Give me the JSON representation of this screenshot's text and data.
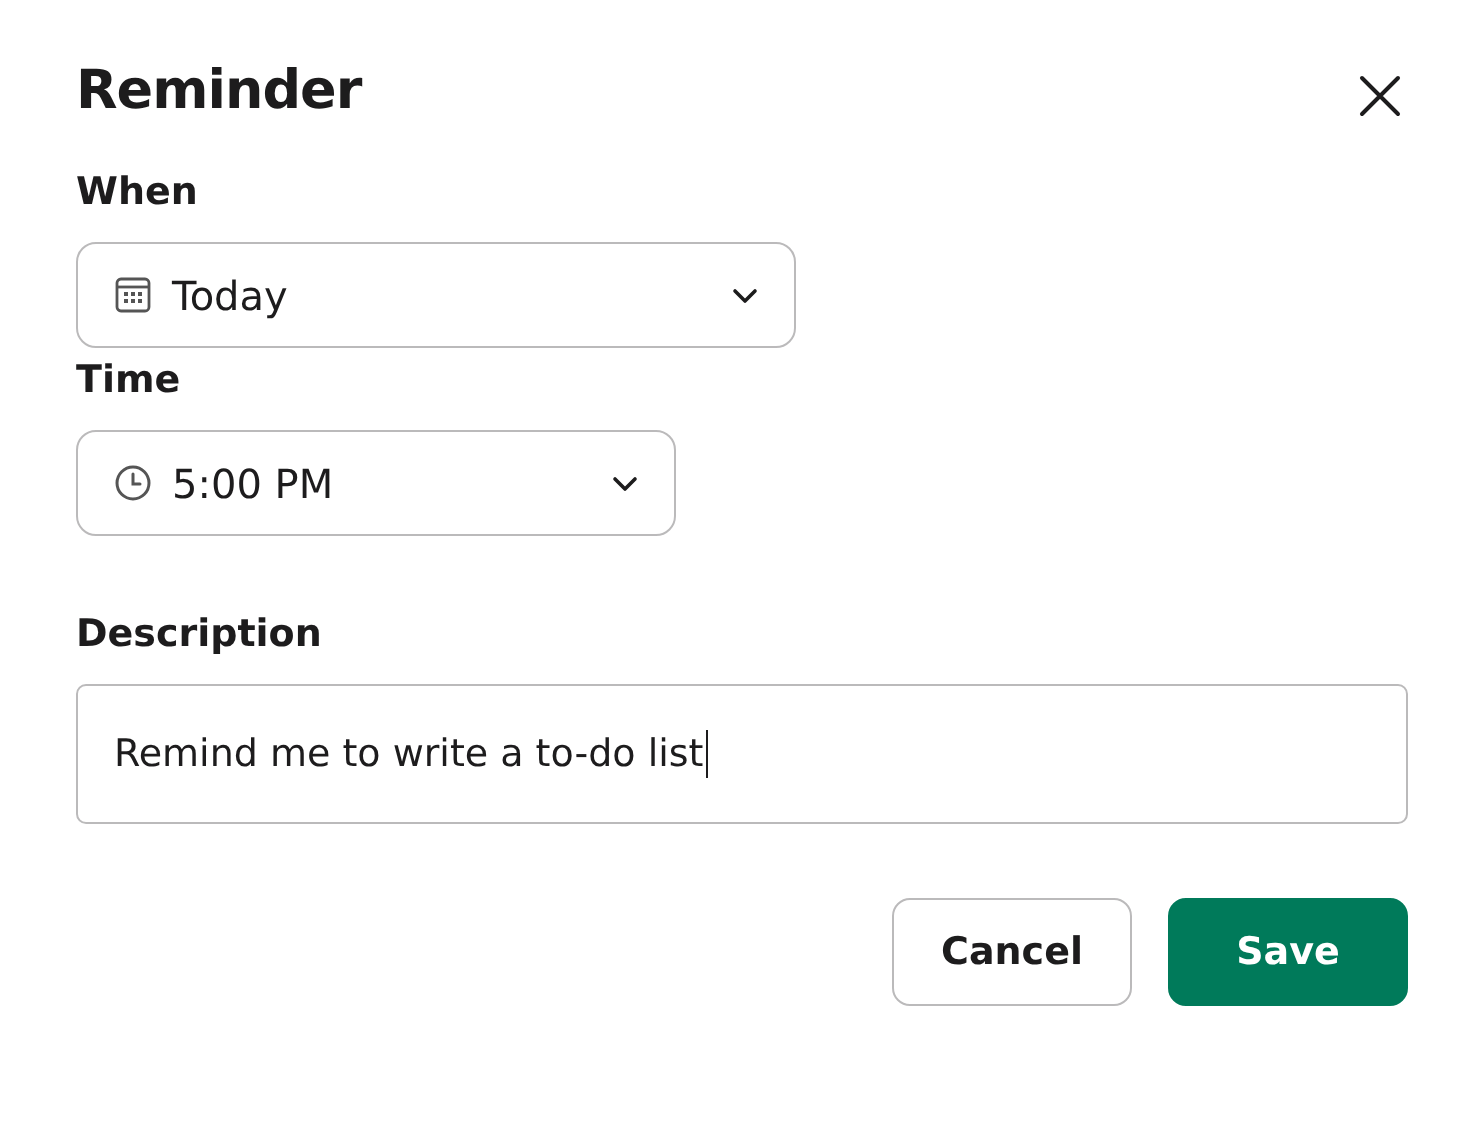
{
  "dialog": {
    "title": "Reminder"
  },
  "fields": [
    {
      "kind": "date",
      "label": "When",
      "value": "Today"
    },
    {
      "kind": "time",
      "label": "Time",
      "value": "5:00 PM"
    }
  ],
  "description": {
    "label": "Description",
    "value": "Remind me to write a to-do list"
  },
  "buttons": [
    {
      "label": "Cancel",
      "kind": "secondary"
    },
    {
      "label": "Save",
      "kind": "primary"
    }
  ]
}
